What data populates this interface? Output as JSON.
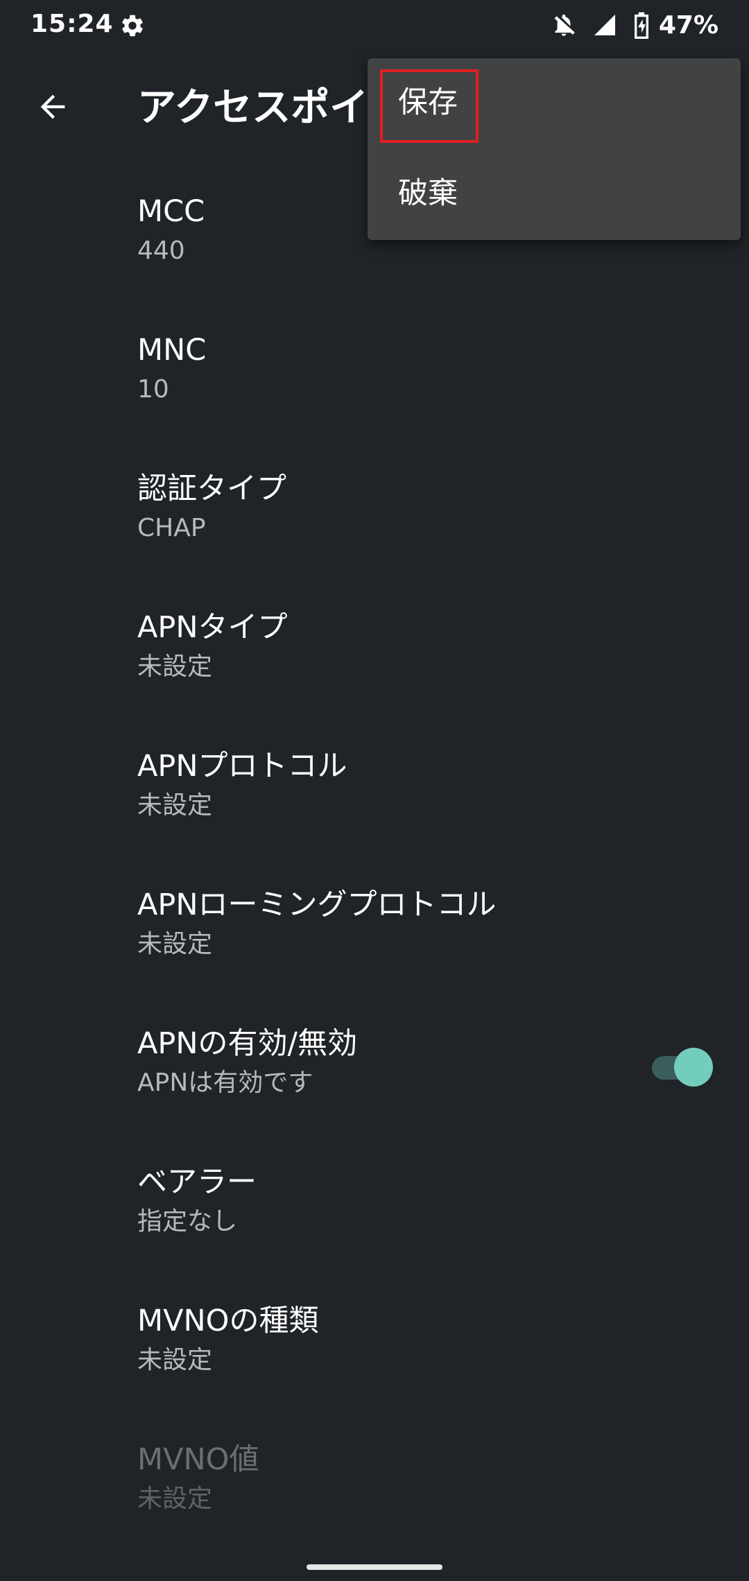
{
  "status_bar": {
    "time": "15:24",
    "battery_percent": "47%",
    "icons": [
      "gear-icon",
      "notifications-off-icon",
      "signal-icon",
      "battery-charging-icon"
    ]
  },
  "app_bar": {
    "title": "アクセスポイ",
    "back_icon": "arrow-back-icon"
  },
  "menu": {
    "items": [
      {
        "label": "保存",
        "highlighted": true
      },
      {
        "label": "破棄",
        "highlighted": false
      }
    ]
  },
  "settings": {
    "items": [
      {
        "title": "MCC",
        "summary": "440"
      },
      {
        "title": "MNC",
        "summary": "10"
      },
      {
        "title": "認証タイプ",
        "summary": "CHAP"
      },
      {
        "title": "APNタイプ",
        "summary": "未設定"
      },
      {
        "title": "APNプロトコル",
        "summary": "未設定"
      },
      {
        "title": "APNローミングプロトコル",
        "summary": "未設定"
      },
      {
        "title": "APNの有効/無効",
        "summary": "APNは有効です",
        "toggle_on": true
      },
      {
        "title": "ベアラー",
        "summary": "指定なし"
      },
      {
        "title": "MVNOの種類",
        "summary": "未設定"
      },
      {
        "title": "MVNO値",
        "summary": "未設定",
        "disabled": true
      }
    ]
  },
  "colors": {
    "background": "#202428",
    "menu_background": "#414244",
    "highlight_border": "#e0201f",
    "toggle_thumb": "#73cdbd",
    "toggle_track": "#3b5e5a",
    "summary_text": "#b7babd"
  }
}
